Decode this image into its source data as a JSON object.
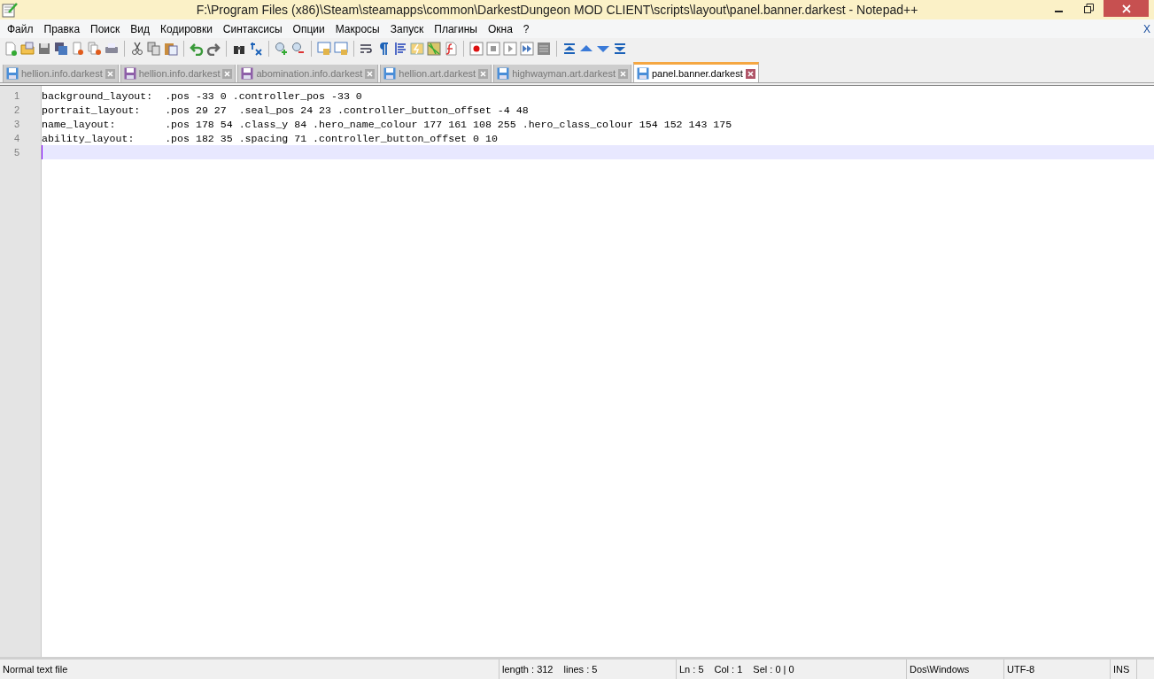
{
  "window": {
    "title": "F:\\Program Files (x86)\\Steam\\steamapps\\common\\DarkestDungeon MOD CLIENT\\scripts\\layout\\panel.banner.darkest - Notepad++"
  },
  "menu": [
    "Файл",
    "Правка",
    "Поиск",
    "Вид",
    "Кодировки",
    "Синтаксисы",
    "Опции",
    "Макросы",
    "Запуск",
    "Плагины",
    "Окна",
    "?"
  ],
  "close_document": "X",
  "tabs": [
    {
      "label": "hellion.info.darkest",
      "selected": false,
      "modified": false
    },
    {
      "label": "hellion.info.darkest",
      "selected": false,
      "modified": true
    },
    {
      "label": "abomination.info.darkest",
      "selected": false,
      "modified": true
    },
    {
      "label": "hellion.art.darkest",
      "selected": false,
      "modified": false
    },
    {
      "label": "highwayman.art.darkest",
      "selected": false,
      "modified": false
    },
    {
      "label": "panel.banner.darkest",
      "selected": true,
      "modified": false
    }
  ],
  "editor": {
    "lines": [
      {
        "number": "1",
        "text": "background_layout:  .pos -33 0 .controller_pos -33 0",
        "current": false
      },
      {
        "number": "2",
        "text": "portrait_layout:    .pos 29 27  .seal_pos 24 23 .controller_button_offset -4 48",
        "current": false
      },
      {
        "number": "3",
        "text": "name_layout:        .pos 178 54 .class_y 84 .hero_name_colour 177 161 108 255 .hero_class_colour 154 152 143 175",
        "current": false
      },
      {
        "number": "4",
        "text": "ability_layout:     .pos 182 35 .spacing 71 .controller_button_offset 0 10",
        "current": false
      },
      {
        "number": "5",
        "current": true
      }
    ]
  },
  "status_bar": {
    "file_type": "Normal text file",
    "length": "length : 312",
    "lines": "lines : 5",
    "ln": "Ln : 5",
    "col": "Col : 1",
    "sel": "Sel : 0 | 0",
    "eol": "Dos\\Windows",
    "encoding": "UTF-8",
    "mode": "INS"
  }
}
